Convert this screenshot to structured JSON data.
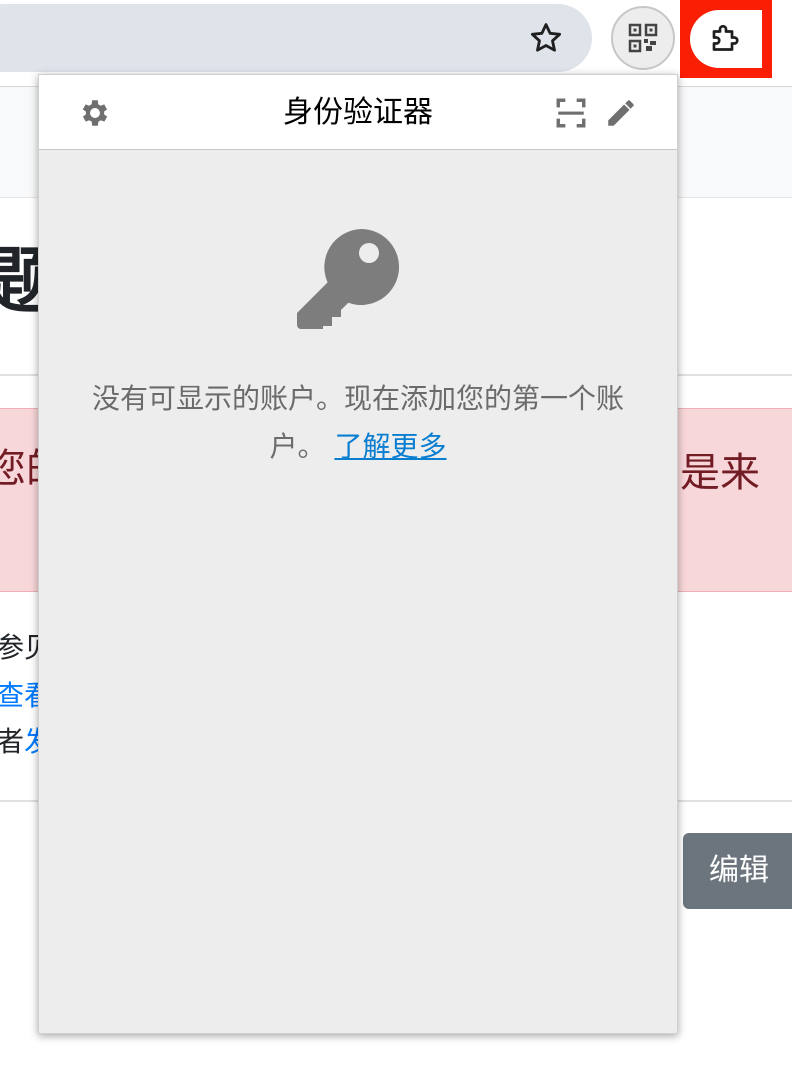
{
  "browser": {
    "icons": {
      "bookmark_star": "star-icon",
      "qr_extension": "qr-code-icon",
      "extensions": "puzzle-icon"
    },
    "highlight_color": "#fa1e05"
  },
  "page": {
    "title_fragment": "题",
    "alert": {
      "left_fragment": "您的",
      "right_fragment": "是来"
    },
    "lines": [
      {
        "text": "参见",
        "link": ""
      },
      {
        "text": "",
        "link": "查看"
      },
      {
        "text": "者",
        "link": "发"
      }
    ],
    "edit_button": "编辑"
  },
  "popup": {
    "title": "身份验证器",
    "icons": {
      "settings": "gear-icon",
      "scan": "scan-qr-icon",
      "edit": "pencil-icon",
      "empty_state": "key-icon"
    },
    "empty_message": "没有可显示的账户。现在添加您的第一个账户。",
    "learn_more": "了解更多"
  }
}
